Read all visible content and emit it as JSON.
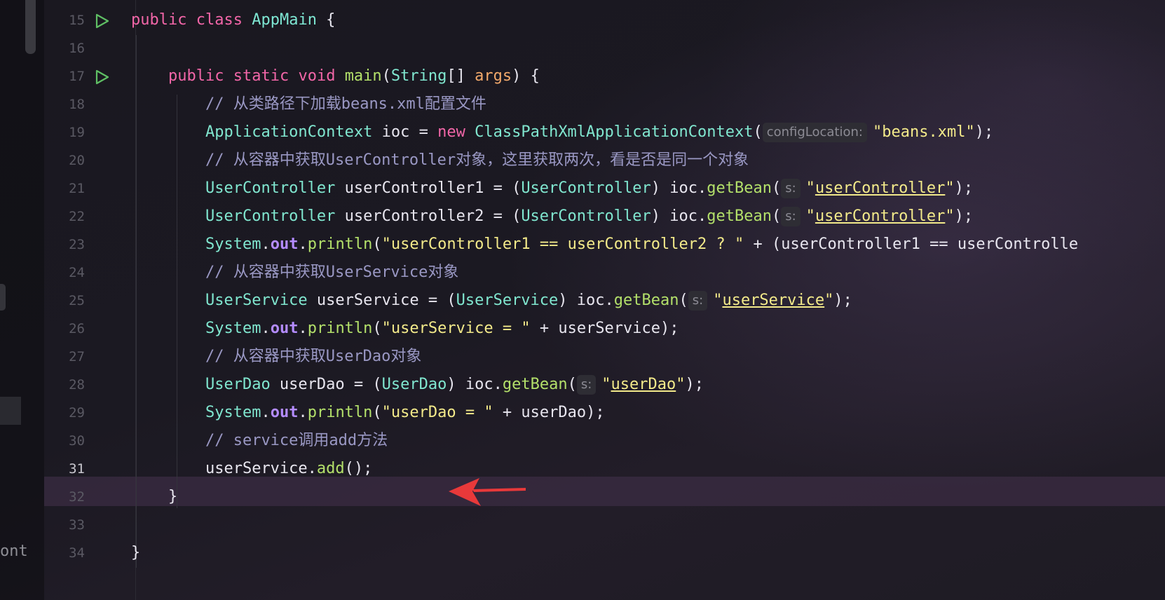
{
  "editor": {
    "left_cut_text": "ont",
    "active_line": "31",
    "lines": [
      {
        "num": "15",
        "run": true,
        "seg": [
          {
            "t": "public",
            "c": "kw"
          },
          {
            "t": " "
          },
          {
            "t": "class",
            "c": "kw"
          },
          {
            "t": " "
          },
          {
            "t": "AppMain",
            "c": "cls"
          },
          {
            "t": " {"
          }
        ]
      },
      {
        "num": "16",
        "seg": []
      },
      {
        "num": "17",
        "run": true,
        "seg": [
          {
            "t": "    "
          },
          {
            "t": "public",
            "c": "kw"
          },
          {
            "t": " "
          },
          {
            "t": "static",
            "c": "kw"
          },
          {
            "t": " "
          },
          {
            "t": "void",
            "c": "kw"
          },
          {
            "t": " "
          },
          {
            "t": "main",
            "c": "fn"
          },
          {
            "t": "("
          },
          {
            "t": "String",
            "c": "type"
          },
          {
            "t": "[] "
          },
          {
            "t": "args",
            "c": "param"
          },
          {
            "t": ") {"
          }
        ]
      },
      {
        "num": "18",
        "seg": [
          {
            "t": "        "
          },
          {
            "t": "// 从类路径下加载beans.xml配置文件",
            "c": "cmt"
          }
        ]
      },
      {
        "num": "19",
        "seg": [
          {
            "t": "        "
          },
          {
            "t": "ApplicationContext",
            "c": "type"
          },
          {
            "t": " ioc = "
          },
          {
            "t": "new",
            "c": "kw"
          },
          {
            "t": " "
          },
          {
            "t": "ClassPathXmlApplicationContext",
            "c": "type"
          },
          {
            "t": "("
          },
          {
            "hint": "configLocation:"
          },
          {
            "t": "\"beans.xml\"",
            "c": "str"
          },
          {
            "t": ");"
          }
        ]
      },
      {
        "num": "20",
        "seg": [
          {
            "t": "        "
          },
          {
            "t": "// 从容器中获取UserController对象，这里获取两次，看是否是同一个对象",
            "c": "cmt"
          }
        ]
      },
      {
        "num": "21",
        "seg": [
          {
            "t": "        "
          },
          {
            "t": "UserController",
            "c": "type"
          },
          {
            "t": " userController1 = ("
          },
          {
            "t": "UserController",
            "c": "type"
          },
          {
            "t": ") ioc."
          },
          {
            "t": "getBean",
            "c": "fn"
          },
          {
            "t": "("
          },
          {
            "hint": "s:"
          },
          {
            "t": "\"",
            "c": "str"
          },
          {
            "t": "userController",
            "c": "str",
            "u": true
          },
          {
            "t": "\"",
            "c": "str"
          },
          {
            "t": ");"
          }
        ]
      },
      {
        "num": "22",
        "seg": [
          {
            "t": "        "
          },
          {
            "t": "UserController",
            "c": "type"
          },
          {
            "t": " userController2 = ("
          },
          {
            "t": "UserController",
            "c": "type"
          },
          {
            "t": ") ioc."
          },
          {
            "t": "getBean",
            "c": "fn"
          },
          {
            "t": "("
          },
          {
            "hint": "s:"
          },
          {
            "t": "\"",
            "c": "str"
          },
          {
            "t": "userController",
            "c": "str",
            "u": true
          },
          {
            "t": "\"",
            "c": "str"
          },
          {
            "t": ");"
          }
        ]
      },
      {
        "num": "23",
        "seg": [
          {
            "t": "        "
          },
          {
            "t": "System",
            "c": "type"
          },
          {
            "t": "."
          },
          {
            "t": "out",
            "c": "fld"
          },
          {
            "t": "."
          },
          {
            "t": "println",
            "c": "fn"
          },
          {
            "t": "("
          },
          {
            "t": "\"userController1 == userController2 ? \"",
            "c": "str"
          },
          {
            "t": " + (userController1 == userControlle"
          }
        ]
      },
      {
        "num": "24",
        "seg": [
          {
            "t": "        "
          },
          {
            "t": "// 从容器中获取UserService对象",
            "c": "cmt"
          }
        ]
      },
      {
        "num": "25",
        "seg": [
          {
            "t": "        "
          },
          {
            "t": "UserService",
            "c": "type"
          },
          {
            "t": " userService = ("
          },
          {
            "t": "UserService",
            "c": "type"
          },
          {
            "t": ") ioc."
          },
          {
            "t": "getBean",
            "c": "fn"
          },
          {
            "t": "("
          },
          {
            "hint": "s:"
          },
          {
            "t": "\"",
            "c": "str"
          },
          {
            "t": "userService",
            "c": "str",
            "u": true
          },
          {
            "t": "\"",
            "c": "str"
          },
          {
            "t": ");"
          }
        ]
      },
      {
        "num": "26",
        "seg": [
          {
            "t": "        "
          },
          {
            "t": "System",
            "c": "type"
          },
          {
            "t": "."
          },
          {
            "t": "out",
            "c": "fld"
          },
          {
            "t": "."
          },
          {
            "t": "println",
            "c": "fn"
          },
          {
            "t": "("
          },
          {
            "t": "\"userService = \"",
            "c": "str"
          },
          {
            "t": " + userService);"
          }
        ]
      },
      {
        "num": "27",
        "seg": [
          {
            "t": "        "
          },
          {
            "t": "// 从容器中获取UserDao对象",
            "c": "cmt"
          }
        ]
      },
      {
        "num": "28",
        "seg": [
          {
            "t": "        "
          },
          {
            "t": "UserDao",
            "c": "type"
          },
          {
            "t": " userDao = ("
          },
          {
            "t": "UserDao",
            "c": "type"
          },
          {
            "t": ") ioc."
          },
          {
            "t": "getBean",
            "c": "fn"
          },
          {
            "t": "("
          },
          {
            "hint": "s:"
          },
          {
            "t": "\"",
            "c": "str"
          },
          {
            "t": "userDao",
            "c": "str",
            "u": true
          },
          {
            "t": "\"",
            "c": "str"
          },
          {
            "t": ");"
          }
        ]
      },
      {
        "num": "29",
        "seg": [
          {
            "t": "        "
          },
          {
            "t": "System",
            "c": "type"
          },
          {
            "t": "."
          },
          {
            "t": "out",
            "c": "fld"
          },
          {
            "t": "."
          },
          {
            "t": "println",
            "c": "fn"
          },
          {
            "t": "("
          },
          {
            "t": "\"userDao = \"",
            "c": "str"
          },
          {
            "t": " + userDao);"
          }
        ]
      },
      {
        "num": "30",
        "seg": [
          {
            "t": "        "
          },
          {
            "t": "// service调用add方法",
            "c": "cmt"
          }
        ]
      },
      {
        "num": "31",
        "seg": [
          {
            "t": "        "
          },
          {
            "t": "userService."
          },
          {
            "t": "add",
            "c": "fn"
          },
          {
            "t": "();"
          }
        ]
      },
      {
        "num": "32",
        "seg": [
          {
            "t": "    }"
          }
        ]
      },
      {
        "num": "33",
        "seg": []
      },
      {
        "num": "34",
        "seg": [
          {
            "t": "}"
          }
        ]
      }
    ]
  },
  "colors": {
    "keyword": "#f266a8",
    "type": "#7ee7d3",
    "method": "#b3e06a",
    "string": "#f3ea8a",
    "comment": "#9a98c4",
    "field": "#b48cff",
    "arrow": "#e8393a"
  },
  "icons": {
    "run": "run-gutter-icon",
    "annotation": "red-arrow-annotation"
  }
}
